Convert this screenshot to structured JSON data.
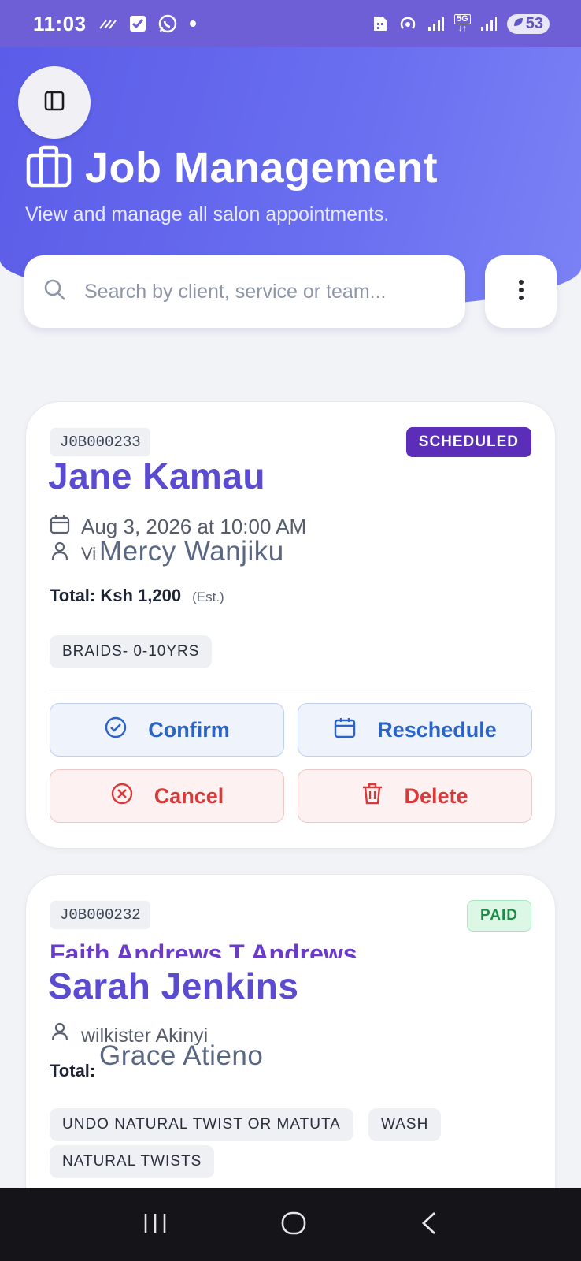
{
  "status_bar": {
    "time": "11:03",
    "battery": "53",
    "network": "5G"
  },
  "header": {
    "title": "Job Management",
    "subtitle": "View and manage all salon appointments."
  },
  "search": {
    "placeholder": "Search by client, service or team..."
  },
  "jobs": [
    {
      "id": "J0B000233",
      "status": "SCHEDULED",
      "client": "Jane Kamau",
      "datetime": "Aug 3, 2026 at 10:00 AM",
      "staff_prefix": "Vi",
      "staff_overlay": "Mercy Wanjiku",
      "total": "Total: Ksh 1,200",
      "est": "(Est.)",
      "tags": [
        "BRAIDS- 0-10YRS"
      ],
      "actions": {
        "confirm": "Confirm",
        "reschedule": "Reschedule",
        "cancel": "Cancel",
        "delete": "Delete"
      }
    },
    {
      "id": "J0B000232",
      "status": "PAID",
      "client_underlay": "Faith Andrews T Andrews",
      "client": "Sarah Jenkins",
      "staff": "wilkister Akinyi",
      "staff_overlay": "Grace Atieno",
      "total": "Total:",
      "tags": [
        "UNDO NATURAL TWIST OR MATUTA",
        "WASH",
        "NATURAL TWISTS"
      ]
    }
  ],
  "colors": {
    "accent": "#5b5ce8",
    "client_name": "#5a4bd1",
    "scheduled_badge": "#5b2db8",
    "paid_badge": "#1f8a46",
    "action_blue": "#2c63c7",
    "action_red": "#d83a3a"
  }
}
